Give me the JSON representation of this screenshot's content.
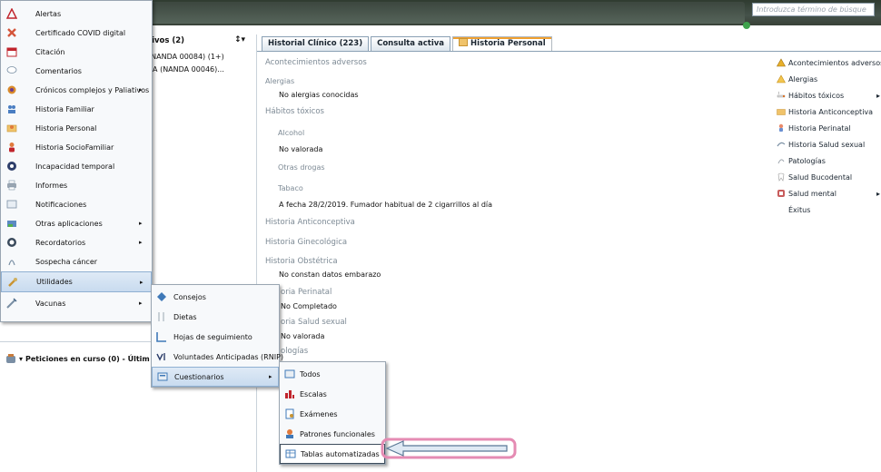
{
  "search": {
    "placeholder": "Introduzca término de búsque"
  },
  "left_panel": {
    "title": "tivos (2)",
    "diagnoses": [
      "(NANDA 00084) (1+)",
      "EA (NANDA 00046)..."
    ],
    "peticiones": "Peticiones en curso (0) - Últim"
  },
  "tabs": [
    {
      "label": "Historial Clínico (223)"
    },
    {
      "label": "Consulta activa"
    },
    {
      "label": "Historia Personal"
    }
  ],
  "content": {
    "acontecimientos": "Acontecimientos adversos",
    "alergias": "Alergias",
    "alergias_val": "No alergias conocidas",
    "habitos": "Hábitos tóxicos",
    "alcohol": "Alcohol",
    "alcohol_val": "No valorada",
    "otras_drogas": "Otras drogas",
    "tabaco": "Tabaco",
    "tabaco_val": "A fecha 28/2/2019. Fumador habitual de 2 cigarrillos al día",
    "anticonceptiva": "Historia Anticonceptiva",
    "ginecologica": "Historia Ginecológica",
    "obstetrica": "Historia Obstétrica",
    "obstetrica_val": "No constan datos embarazo",
    "perinatal": "oria Perinatal",
    "perinatal_val": "No Completado",
    "salud_sexual": "oria Salud sexual",
    "salud_sexual_val": "No valorada",
    "patologias": "ologías"
  },
  "right_list": [
    {
      "label": "Acontecimientos adversos",
      "icon": "warning-icon"
    },
    {
      "label": "Alergias",
      "icon": "allergy-icon"
    },
    {
      "label": "Hábitos tóxicos",
      "icon": "cigarette-icon",
      "arrow": "▸"
    },
    {
      "label": "Historia Anticonceptiva",
      "icon": "folder-icon"
    },
    {
      "label": "Historia Perinatal",
      "icon": "baby-icon"
    },
    {
      "label": "Historia Salud sexual",
      "icon": "sexual-health-icon"
    },
    {
      "label": "Patologías",
      "icon": "pathology-icon"
    },
    {
      "label": "Salud Bucodental",
      "icon": "tooth-icon"
    },
    {
      "label": "Salud mental",
      "icon": "mental-health-icon",
      "arrow": "▸"
    },
    {
      "label": "Éxitus",
      "icon": "exitus-icon"
    }
  ],
  "menu": [
    {
      "label": "Alertas"
    },
    {
      "label": "Certificado COVID digital"
    },
    {
      "label": "Citación"
    },
    {
      "label": "Comentarios"
    },
    {
      "label": "Crónicos complejos y Paliativos",
      "arrow": "▸"
    },
    {
      "label": "Historia Familiar"
    },
    {
      "label": "Historia Personal"
    },
    {
      "label": "Historia SocioFamiliar"
    },
    {
      "label": "Incapacidad temporal"
    },
    {
      "label": "Informes"
    },
    {
      "label": "Notificaciones"
    },
    {
      "label": "Otras aplicaciones",
      "arrow": "▸"
    },
    {
      "label": "Recordatorios",
      "arrow": "▸"
    },
    {
      "label": "Sospecha cáncer"
    },
    {
      "label": "Utilidades",
      "arrow": "▸"
    },
    {
      "label": "Vacunas",
      "arrow": "▸"
    }
  ],
  "submenu_utilidades": [
    {
      "label": "Consejos"
    },
    {
      "label": "Dietas"
    },
    {
      "label": "Hojas de seguimiento"
    },
    {
      "label": "Voluntades Anticipadas (RNIP)"
    },
    {
      "label": "Cuestionarios",
      "arrow": "▸"
    }
  ],
  "submenu_cuestionarios": [
    {
      "label": "Todos"
    },
    {
      "label": "Escalas"
    },
    {
      "label": "Exámenes"
    },
    {
      "label": "Patrones funcionales"
    },
    {
      "label": "Tablas automatizadas"
    }
  ],
  "colors": {
    "accent": "#8fb0d2",
    "annotation": "#e58bb3"
  }
}
